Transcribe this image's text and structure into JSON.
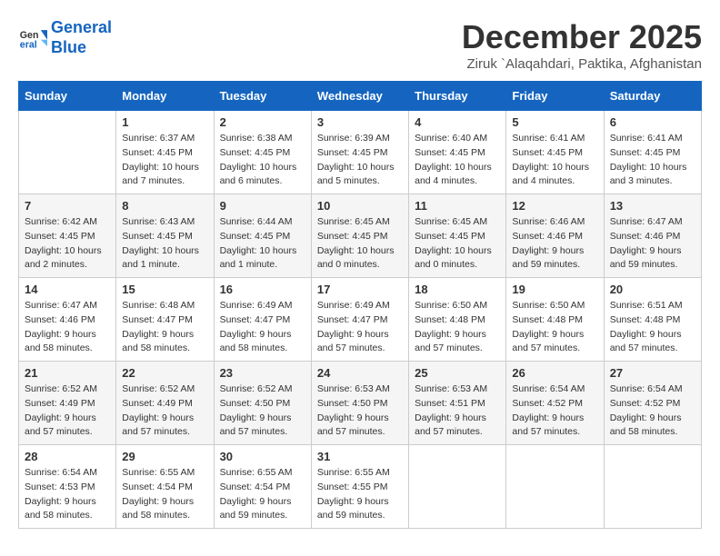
{
  "header": {
    "logo_line1": "General",
    "logo_line2": "Blue",
    "title": "December 2025",
    "location": "Ziruk `Alaqahdari, Paktika, Afghanistan"
  },
  "days_of_week": [
    "Sunday",
    "Monday",
    "Tuesday",
    "Wednesday",
    "Thursday",
    "Friday",
    "Saturday"
  ],
  "weeks": [
    [
      {
        "day": "",
        "info": ""
      },
      {
        "day": "1",
        "info": "Sunrise: 6:37 AM\nSunset: 4:45 PM\nDaylight: 10 hours\nand 7 minutes."
      },
      {
        "day": "2",
        "info": "Sunrise: 6:38 AM\nSunset: 4:45 PM\nDaylight: 10 hours\nand 6 minutes."
      },
      {
        "day": "3",
        "info": "Sunrise: 6:39 AM\nSunset: 4:45 PM\nDaylight: 10 hours\nand 5 minutes."
      },
      {
        "day": "4",
        "info": "Sunrise: 6:40 AM\nSunset: 4:45 PM\nDaylight: 10 hours\nand 4 minutes."
      },
      {
        "day": "5",
        "info": "Sunrise: 6:41 AM\nSunset: 4:45 PM\nDaylight: 10 hours\nand 4 minutes."
      },
      {
        "day": "6",
        "info": "Sunrise: 6:41 AM\nSunset: 4:45 PM\nDaylight: 10 hours\nand 3 minutes."
      }
    ],
    [
      {
        "day": "7",
        "info": "Sunrise: 6:42 AM\nSunset: 4:45 PM\nDaylight: 10 hours\nand 2 minutes."
      },
      {
        "day": "8",
        "info": "Sunrise: 6:43 AM\nSunset: 4:45 PM\nDaylight: 10 hours\nand 1 minute."
      },
      {
        "day": "9",
        "info": "Sunrise: 6:44 AM\nSunset: 4:45 PM\nDaylight: 10 hours\nand 1 minute."
      },
      {
        "day": "10",
        "info": "Sunrise: 6:45 AM\nSunset: 4:45 PM\nDaylight: 10 hours\nand 0 minutes."
      },
      {
        "day": "11",
        "info": "Sunrise: 6:45 AM\nSunset: 4:45 PM\nDaylight: 10 hours\nand 0 minutes."
      },
      {
        "day": "12",
        "info": "Sunrise: 6:46 AM\nSunset: 4:46 PM\nDaylight: 9 hours\nand 59 minutes."
      },
      {
        "day": "13",
        "info": "Sunrise: 6:47 AM\nSunset: 4:46 PM\nDaylight: 9 hours\nand 59 minutes."
      }
    ],
    [
      {
        "day": "14",
        "info": "Sunrise: 6:47 AM\nSunset: 4:46 PM\nDaylight: 9 hours\nand 58 minutes."
      },
      {
        "day": "15",
        "info": "Sunrise: 6:48 AM\nSunset: 4:47 PM\nDaylight: 9 hours\nand 58 minutes."
      },
      {
        "day": "16",
        "info": "Sunrise: 6:49 AM\nSunset: 4:47 PM\nDaylight: 9 hours\nand 58 minutes."
      },
      {
        "day": "17",
        "info": "Sunrise: 6:49 AM\nSunset: 4:47 PM\nDaylight: 9 hours\nand 57 minutes."
      },
      {
        "day": "18",
        "info": "Sunrise: 6:50 AM\nSunset: 4:48 PM\nDaylight: 9 hours\nand 57 minutes."
      },
      {
        "day": "19",
        "info": "Sunrise: 6:50 AM\nSunset: 4:48 PM\nDaylight: 9 hours\nand 57 minutes."
      },
      {
        "day": "20",
        "info": "Sunrise: 6:51 AM\nSunset: 4:48 PM\nDaylight: 9 hours\nand 57 minutes."
      }
    ],
    [
      {
        "day": "21",
        "info": "Sunrise: 6:52 AM\nSunset: 4:49 PM\nDaylight: 9 hours\nand 57 minutes."
      },
      {
        "day": "22",
        "info": "Sunrise: 6:52 AM\nSunset: 4:49 PM\nDaylight: 9 hours\nand 57 minutes."
      },
      {
        "day": "23",
        "info": "Sunrise: 6:52 AM\nSunset: 4:50 PM\nDaylight: 9 hours\nand 57 minutes."
      },
      {
        "day": "24",
        "info": "Sunrise: 6:53 AM\nSunset: 4:50 PM\nDaylight: 9 hours\nand 57 minutes."
      },
      {
        "day": "25",
        "info": "Sunrise: 6:53 AM\nSunset: 4:51 PM\nDaylight: 9 hours\nand 57 minutes."
      },
      {
        "day": "26",
        "info": "Sunrise: 6:54 AM\nSunset: 4:52 PM\nDaylight: 9 hours\nand 57 minutes."
      },
      {
        "day": "27",
        "info": "Sunrise: 6:54 AM\nSunset: 4:52 PM\nDaylight: 9 hours\nand 58 minutes."
      }
    ],
    [
      {
        "day": "28",
        "info": "Sunrise: 6:54 AM\nSunset: 4:53 PM\nDaylight: 9 hours\nand 58 minutes."
      },
      {
        "day": "29",
        "info": "Sunrise: 6:55 AM\nSunset: 4:54 PM\nDaylight: 9 hours\nand 58 minutes."
      },
      {
        "day": "30",
        "info": "Sunrise: 6:55 AM\nSunset: 4:54 PM\nDaylight: 9 hours\nand 59 minutes."
      },
      {
        "day": "31",
        "info": "Sunrise: 6:55 AM\nSunset: 4:55 PM\nDaylight: 9 hours\nand 59 minutes."
      },
      {
        "day": "",
        "info": ""
      },
      {
        "day": "",
        "info": ""
      },
      {
        "day": "",
        "info": ""
      }
    ]
  ]
}
